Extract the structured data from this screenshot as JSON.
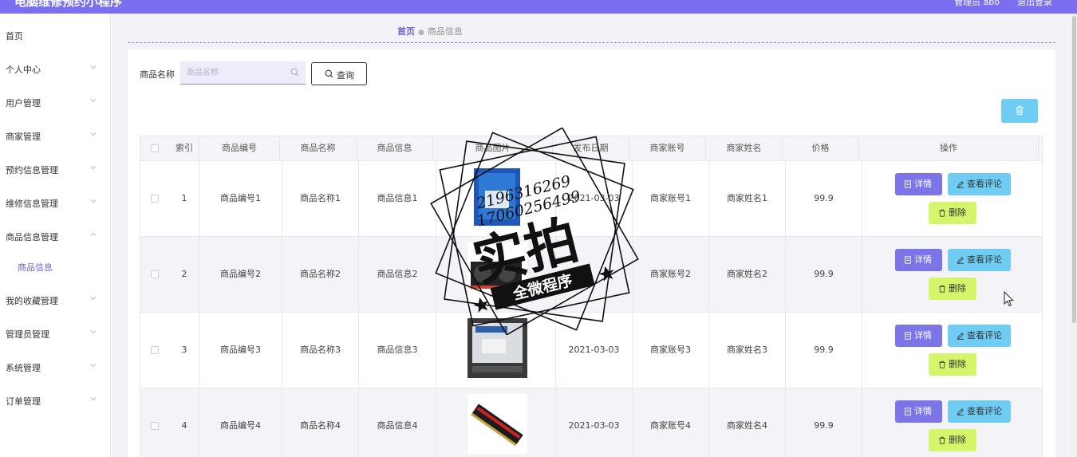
{
  "header": {
    "title": "电脑维修预约小程序",
    "admin": "管理员 abo",
    "logout": "退出登录"
  },
  "sidebar": {
    "items": [
      {
        "label": "首页"
      },
      {
        "label": "个人中心"
      },
      {
        "label": "用户管理"
      },
      {
        "label": "商家管理"
      },
      {
        "label": "预约信息管理"
      },
      {
        "label": "维修信息管理"
      },
      {
        "label": "商品信息管理"
      },
      {
        "label": "商品信息"
      },
      {
        "label": "我的收藏管理"
      },
      {
        "label": "管理员管理"
      },
      {
        "label": "系统管理"
      },
      {
        "label": "订单管理"
      }
    ]
  },
  "breadcrumb": {
    "home": "首页",
    "current": "商品信息"
  },
  "search": {
    "label": "商品名称",
    "placeholder": "商品名称",
    "value": "",
    "button": "查询"
  },
  "table": {
    "headers": [
      "索引",
      "商品编号",
      "商品名称",
      "商品信息",
      "商品图片",
      "发布日期",
      "商家账号",
      "商家姓名",
      "价格",
      "操作"
    ],
    "rows": [
      {
        "index": "1",
        "code": "商品编号1",
        "name": "商品名称1",
        "info": "商品信息1",
        "date": "2021-03-03",
        "account": "商家账号1",
        "merchant": "商家姓名1",
        "price": "99.9"
      },
      {
        "index": "2",
        "code": "商品编号2",
        "name": "商品名称2",
        "info": "商品信息2",
        "date": "",
        "account": "商家账号2",
        "merchant": "商家姓名2",
        "price": "99.9"
      },
      {
        "index": "3",
        "code": "商品编号3",
        "name": "商品名称3",
        "info": "商品信息3",
        "date": "2021-03-03",
        "account": "商家账号3",
        "merchant": "商家姓名3",
        "price": "99.9"
      },
      {
        "index": "4",
        "code": "商品编号4",
        "name": "商品名称4",
        "info": "商品信息4",
        "date": "2021-03-03",
        "account": "商家账号4",
        "merchant": "商家姓名4",
        "price": "99.9"
      }
    ],
    "actions": {
      "detail": "详情",
      "comments": "查看评论",
      "delete": "删除"
    }
  },
  "watermark": {
    "qq1": "2196316269",
    "qq2": "17060256499",
    "big": "实拍",
    "small": "全微程序"
  },
  "colors": {
    "accent": "#7a6ff0",
    "detail": "#7c75e8",
    "comment": "#6fcdf3",
    "delete": "#d5f56b"
  }
}
